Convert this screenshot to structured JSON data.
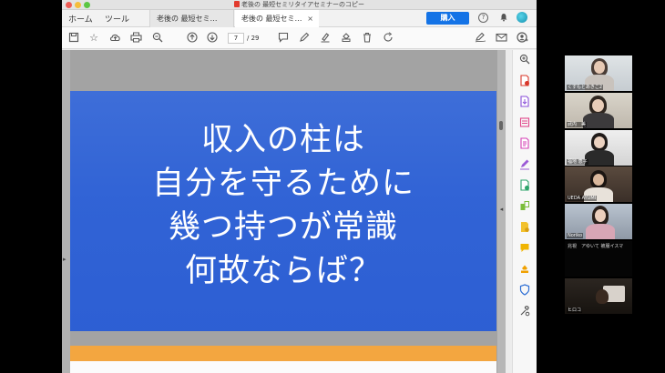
{
  "window": {
    "title": "老後の 最短セミリタイアセミナーのコピー"
  },
  "tabs": {
    "home": "ホーム",
    "tools": "ツール",
    "doc1": "老後の 最短セミ…",
    "doc2": "老後の 最短セミ…",
    "close": "×"
  },
  "header": {
    "buy_label": "購入",
    "help_icon": "?"
  },
  "toolbar": {
    "page_current": "7",
    "page_total": "/ 29",
    "icons": [
      "save-icon",
      "star-icon",
      "upload-icon",
      "print-icon",
      "zoom-out-icon",
      "page-up-icon",
      "page-down-icon",
      "comment-icon",
      "pen-icon",
      "highlight-icon",
      "stamp-icon",
      "trash-icon",
      "rotate-icon",
      "sign-icon",
      "mail-icon",
      "share-user-icon"
    ]
  },
  "slide": {
    "line1": "収入の柱は",
    "line2": "自分を守るために",
    "line3": "幾つ持つが常識",
    "line4": "何故ならば？",
    "background": "#2f63d6"
  },
  "participants": [
    {
      "name": "くすもとあきこ2"
    },
    {
      "name": "武内　美"
    },
    {
      "name": "福地 恵子"
    },
    {
      "name": "UEDA AYUMI"
    },
    {
      "name": "Noriko"
    },
    {
      "name": "兆視　アゆいて 被服イスマ"
    },
    {
      "name": "ヒロコ"
    }
  ],
  "colors": {
    "accent": "#1473e6",
    "slide_blue": "#2f63d6",
    "next_page_band": "#f3a640"
  }
}
